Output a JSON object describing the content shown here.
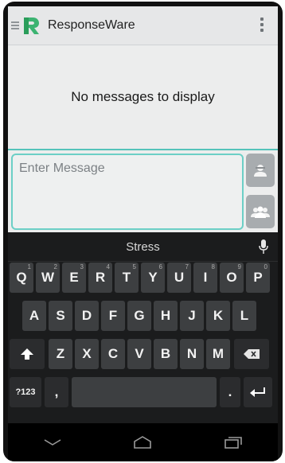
{
  "app": {
    "title": "ResponseWare",
    "brand_color": "#3cb371",
    "accent_color": "#55c3ba"
  },
  "icons": {
    "drawer": "drawer-indicator-icon",
    "logo": "responseware-logo-icon",
    "overflow": "overflow-menu-icon",
    "send_one": "single-person-icon",
    "send_all": "group-icon",
    "mic": "microphone-icon",
    "back": "back-nav-icon",
    "home": "home-nav-icon",
    "recents": "recents-nav-icon"
  },
  "messages": {
    "empty_text": "No messages to display"
  },
  "compose": {
    "placeholder": "Enter Message"
  },
  "keyboard": {
    "suggestion": "Stress",
    "row1": [
      "Q",
      "W",
      "E",
      "R",
      "T",
      "Y",
      "U",
      "I",
      "O",
      "P"
    ],
    "row1_alt": [
      "1",
      "2",
      "3",
      "4",
      "5",
      "6",
      "7",
      "8",
      "9",
      "0"
    ],
    "row2": [
      "A",
      "S",
      "D",
      "F",
      "G",
      "H",
      "J",
      "K",
      "L"
    ],
    "row3": [
      "Z",
      "X",
      "C",
      "V",
      "B",
      "N",
      "M"
    ],
    "symbols_label": "?123",
    "comma_label": ",",
    "period_label": "."
  }
}
